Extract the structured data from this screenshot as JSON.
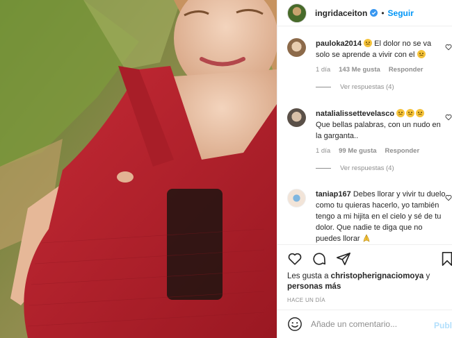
{
  "post": {
    "username": "ingridaceiton",
    "follow_label": "Seguir",
    "separator": "•"
  },
  "comments": [
    {
      "username": "pauloka2014",
      "text": "El dolor no se va solo se aprende a vivir con el",
      "time": "1 día",
      "likes": "143 Me gusta",
      "reply_label": "Responder",
      "view_replies": "Ver respuestas (4)"
    },
    {
      "username": "natalialissettevelasco",
      "text": "Que bellas palabras, con un nudo en la garganta..",
      "time": "1 día",
      "likes": "99 Me gusta",
      "reply_label": "Responder",
      "view_replies": "Ver respuestas (4)"
    },
    {
      "username": "taniap167",
      "text": "Debes llorar y vivir tu duelo como tu quieras hacerlo, yo también tengo a mi hijita en el cielo y sé de tu dolor. Que nadie te diga que no puedes llorar"
    }
  ],
  "likes": {
    "prefix": "Les gusta a",
    "user": "christopherignaciomoya",
    "middle": "y",
    "others": "personas más"
  },
  "time_ago": "HACE UN DÍA",
  "add_comment": {
    "placeholder": "Añade un comentario...",
    "publish_label": "Publi"
  },
  "icons": [
    "verified-badge-icon",
    "heart-icon",
    "comment-icon",
    "share-icon",
    "bookmark-icon",
    "emoji-icon"
  ],
  "colors": {
    "accent": "#0095f6",
    "text": "#262626",
    "muted": "#8e8e8e",
    "dress": "#b3202a"
  }
}
